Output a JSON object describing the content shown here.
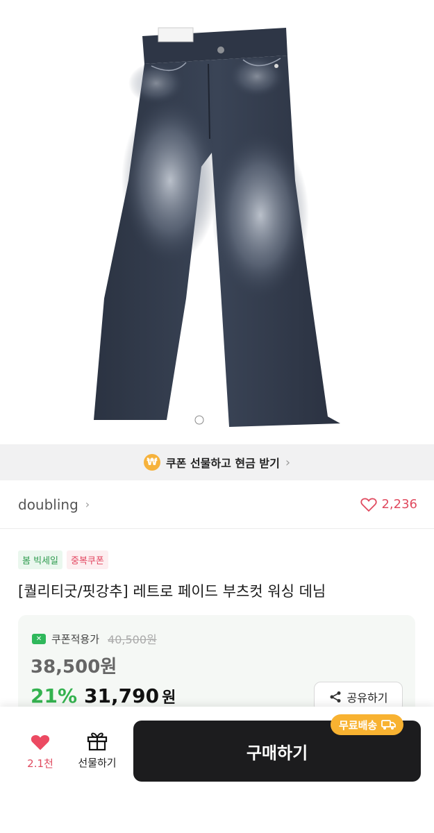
{
  "image": {
    "alt": ""
  },
  "coupon_gift": {
    "label": "쿠폰 선물하고 현금 받기",
    "coin_symbol": "₩"
  },
  "seller": {
    "name": "doubling",
    "likes": "2,236"
  },
  "tags": [
    "봄 빅세일",
    "중복쿠폰"
  ],
  "product": {
    "title": "[퀄리티굿/핏강추] 레트로 페이드 부츠컷 워싱 데님"
  },
  "price": {
    "coupon_label": "쿠폰적용가",
    "original": "40,500원",
    "sale": "38,500원",
    "discount": "21%",
    "final": "31,790",
    "unit": "원"
  },
  "share": {
    "label": "공유하기"
  },
  "bottom": {
    "wish_count": "2.1천",
    "gift_label": "선물하기",
    "buy_label": "구매하기",
    "free_shipping": "무료배송"
  },
  "colors": {
    "accent_green": "#34b24f",
    "heart": "#e04a5f",
    "badge": "#f8b231"
  }
}
